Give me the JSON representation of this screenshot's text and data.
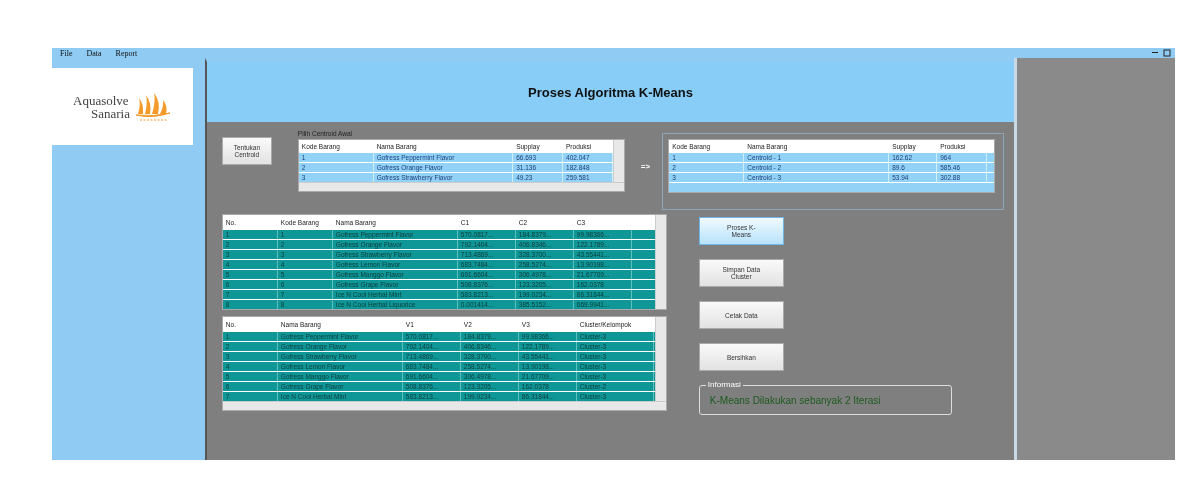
{
  "menu": [
    "File",
    "Data",
    "Report"
  ],
  "logo": {
    "line1": "Aquasolve",
    "line2": "Sanaria"
  },
  "title": "Proses Algoritma K-Means",
  "tentukan_button": "Tentukan Centroid",
  "centroid_awal": {
    "label": "Pilih Centroid Awal",
    "columns": [
      "Kode Barang",
      "Nama Barang",
      "Supplay",
      "Produksi"
    ],
    "rows": [
      [
        "1",
        "Gofress Peppermint Flavor",
        "66.693",
        "402.047"
      ],
      [
        "2",
        "Gofress Orange Flavor",
        "31.136",
        "182.848"
      ],
      [
        "3",
        "Gofress Strawberry Flavor",
        "49.23",
        "259.581"
      ]
    ]
  },
  "arrow": "=>",
  "centroid_table": {
    "columns": [
      "Kode Barang",
      "Nama Barang",
      "Supplay",
      "Produksi"
    ],
    "rows": [
      [
        "1",
        "Centroid - 1",
        "162.62",
        "964"
      ],
      [
        "2",
        "Centroid - 2",
        "89.6",
        "585.46"
      ],
      [
        "3",
        "Centroid - 3",
        "53.94",
        "302.88"
      ]
    ]
  },
  "distance_table": {
    "columns": [
      "No.",
      "Kode Barang",
      "Nama Barang",
      "C1",
      "C2",
      "C3"
    ],
    "rows": [
      [
        "1",
        "1",
        "Gofress Peppermint Flavor",
        "570.0817...",
        "184.8379...",
        "99.98366..."
      ],
      [
        "2",
        "2",
        "Gofress Orange Flavor",
        "792.1404...",
        "406.8346...",
        "122.1789..."
      ],
      [
        "3",
        "3",
        "Gofress Strawberry Flavor",
        "713.4869...",
        "328.3700...",
        "43.55441..."
      ],
      [
        "4",
        "4",
        "Gofress Lemon Flavor",
        "683.7484...",
        "258.5274...",
        "13.90198..."
      ],
      [
        "5",
        "5",
        "Gofress Manggo  Flavor",
        "691.6604...",
        "306.4978...",
        "21.67709..."
      ],
      [
        "6",
        "6",
        "Gofress Grape Flavor",
        "508.8376...",
        "123.3205...",
        "162.0378"
      ],
      [
        "7",
        "7",
        "Ice N Cool Herbal Mint",
        "583.8213...",
        "199.0234...",
        "86.31844..."
      ],
      [
        "8",
        "8",
        "Ice N Cool Herbal Liquorice",
        "0.001414...",
        "385.5152...",
        "669.9941..."
      ]
    ]
  },
  "cluster_table": {
    "columns": [
      "No.",
      "Nama Barang",
      "V1",
      "V2",
      "V3",
      "Cluster/Kelompok"
    ],
    "rows": [
      [
        "1",
        "Gofress Peppermint Flavor",
        "570.0817...",
        "184.8379...",
        "99.98366...",
        "Cluster-3"
      ],
      [
        "2",
        "Gofress Orange Flavor",
        "792.1404...",
        "406.8346...",
        "122.1789...",
        "Cluster-3"
      ],
      [
        "3",
        "Gofress Strawberry Flavor",
        "713.4869...",
        "328.3700...",
        "43.55441...",
        "Cluster-3"
      ],
      [
        "4",
        "Gofress Lemon Flavor",
        "683.7484...",
        "258.5274...",
        "13.90198...",
        "Cluster-3"
      ],
      [
        "5",
        "Gofress Manggo  Flavor",
        "691.6604...",
        "306.4978...",
        "21.67709...",
        "Cluster-3"
      ],
      [
        "6",
        "Gofress Grape Flavor",
        "508.8376...",
        "123.3205...",
        "162.0378",
        "Cluster-2"
      ],
      [
        "7",
        "Ice N Cool Herbal Mint",
        "583.8213...",
        "199.0234...",
        "86.31844...",
        "Cluster-3"
      ]
    ]
  },
  "buttons": [
    {
      "label": "Proses K-Means",
      "focused": true
    },
    {
      "label": "Simpan Data Cluster",
      "focused": false
    },
    {
      "label": "Cetak Data",
      "focused": false
    },
    {
      "label": "Bersihkan",
      "focused": false
    }
  ],
  "info": {
    "label": "Informasi",
    "message": "K-Means Dilakukan sebanyak 2 Iterasi"
  }
}
